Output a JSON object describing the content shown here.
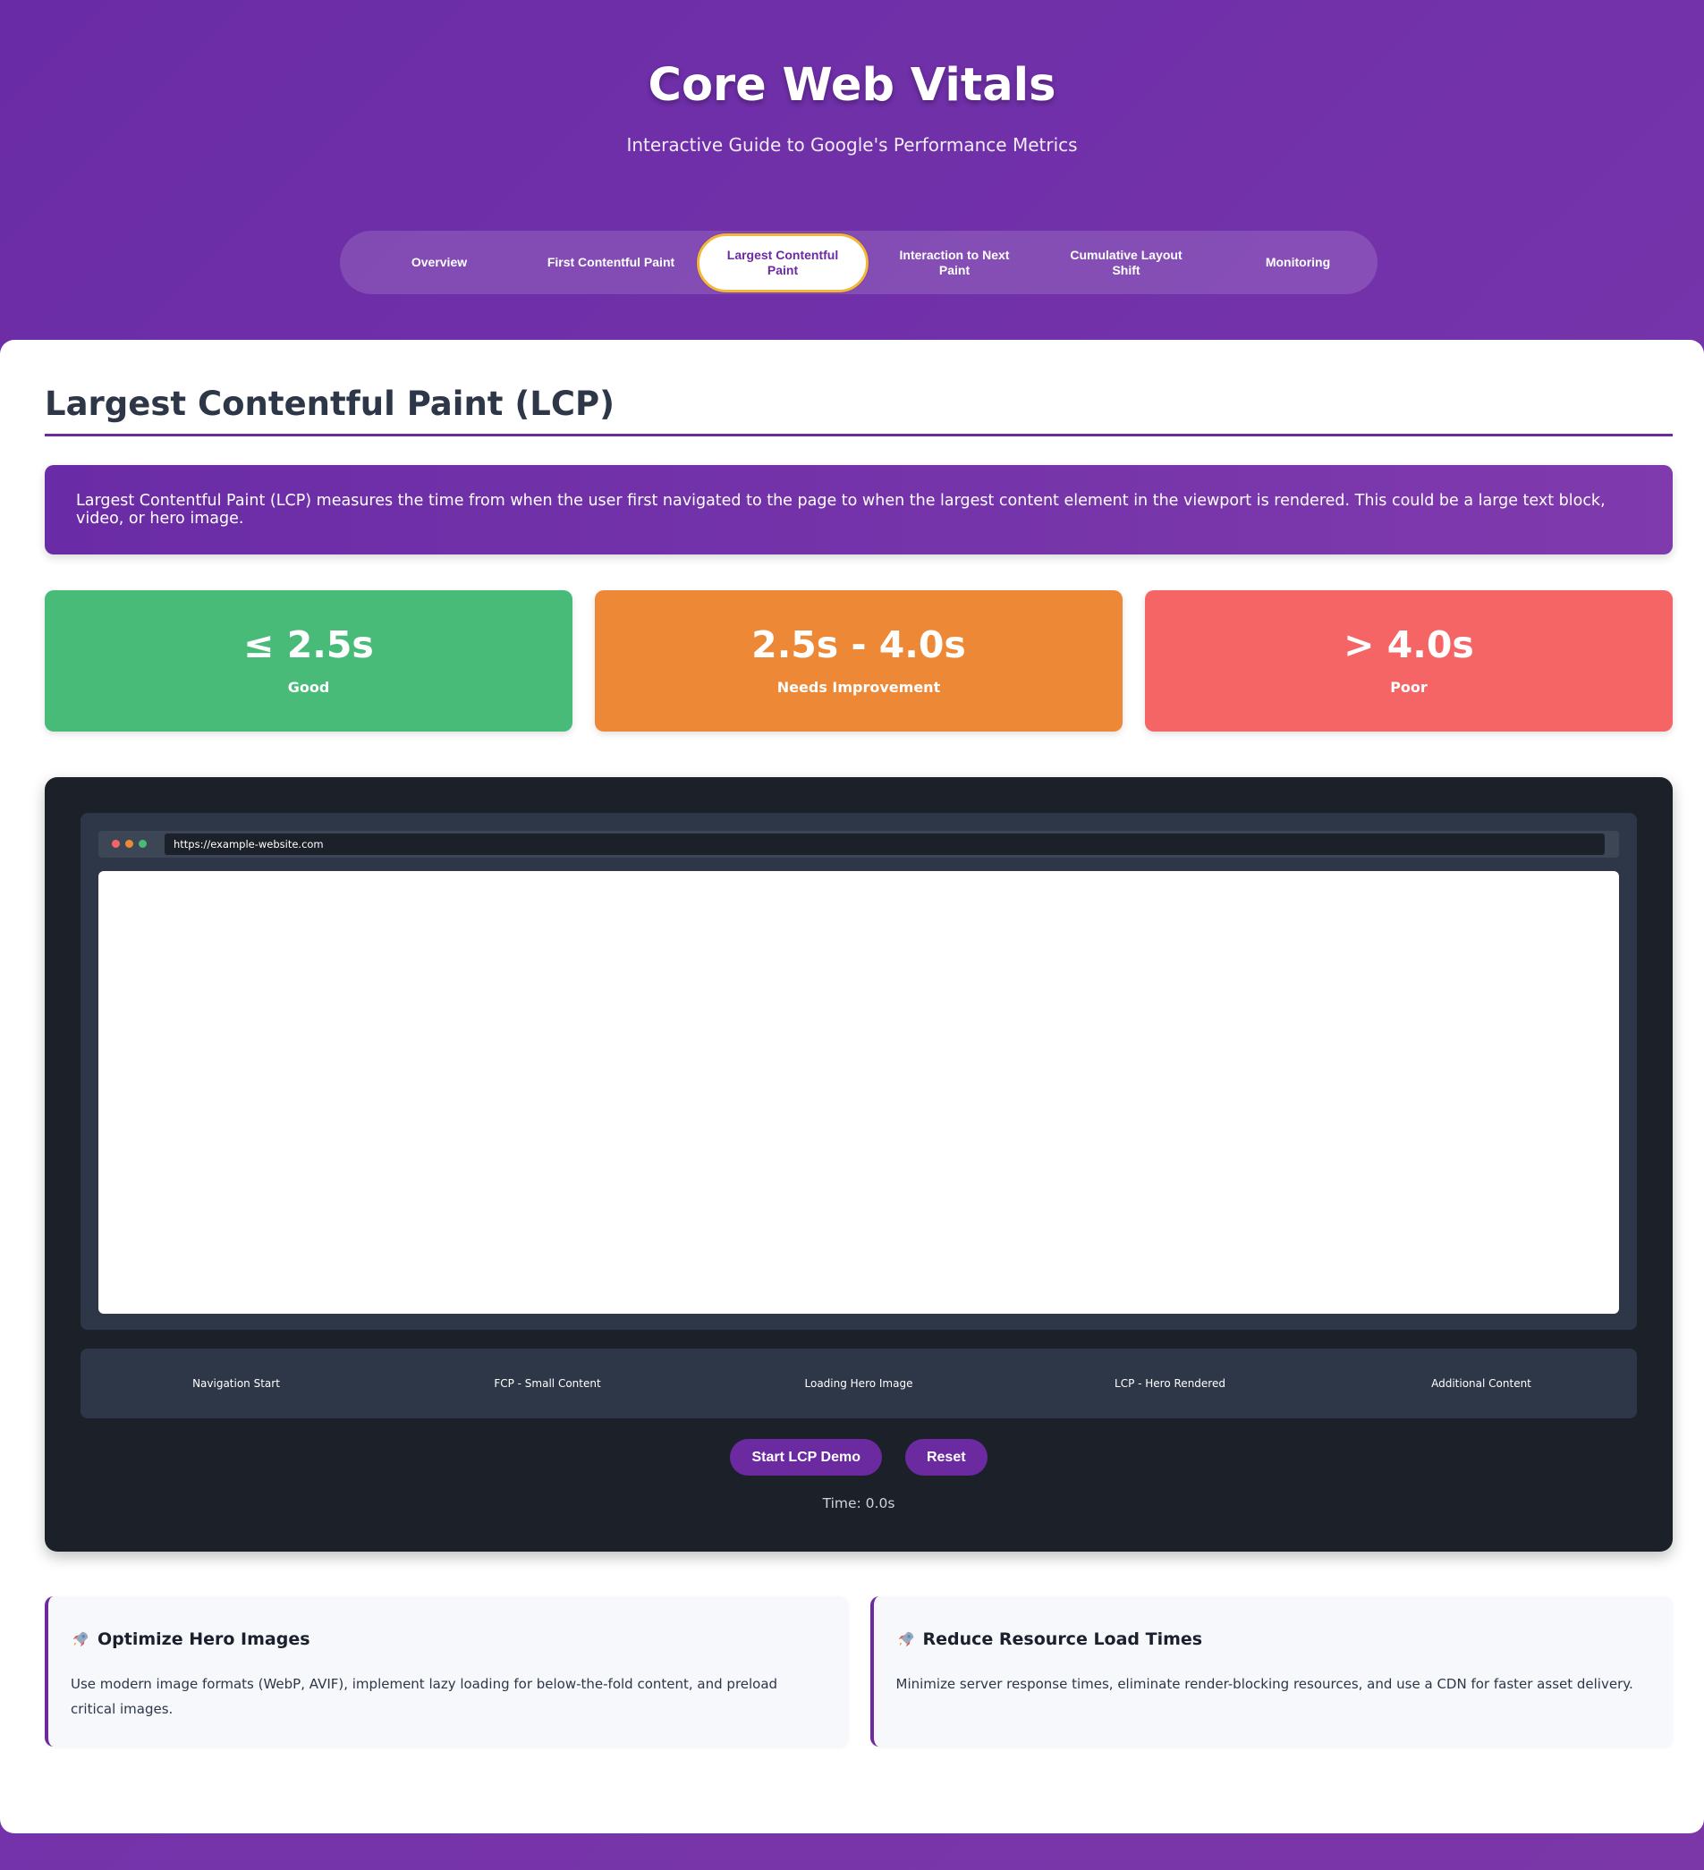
{
  "header": {
    "title": "Core Web Vitals",
    "subtitle": "Interactive Guide to Google's Performance Metrics"
  },
  "nav": {
    "tabs": [
      {
        "label": "Overview",
        "active": false
      },
      {
        "label": "First Contentful Paint",
        "active": false
      },
      {
        "label": "Largest Contentful Paint",
        "active": true
      },
      {
        "label": "Interaction to Next Paint",
        "active": false
      },
      {
        "label": "Cumulative Layout Shift",
        "active": false
      },
      {
        "label": "Monitoring",
        "active": false
      }
    ]
  },
  "section": {
    "title": "Largest Contentful Paint (LCP)",
    "intro": "Largest Contentful Paint (LCP) measures the time from when the user first navigated to the page to when the largest content element in the viewport is rendered. This could be a large text block, video, or hero image."
  },
  "thresholds": [
    {
      "value": "≤ 2.5s",
      "label": "Good",
      "color": "#48bb78"
    },
    {
      "value": "2.5s - 4.0s",
      "label": "Needs Improvement",
      "color": "#ed8936"
    },
    {
      "value": "> 4.0s",
      "label": "Poor",
      "color": "#f56565"
    }
  ],
  "demo": {
    "url": "https://example-website.com",
    "stages": [
      "Navigation Start",
      "FCP - Small Content",
      "Loading Hero Image",
      "LCP - Hero Rendered",
      "Additional Content"
    ],
    "start_label": "Start LCP Demo",
    "reset_label": "Reset",
    "time": "Time: 0.0s"
  },
  "tips": [
    {
      "icon": "rocket-icon",
      "title": "Optimize Hero Images",
      "body": "Use modern image formats (WebP, AVIF), implement lazy loading for below-the-fold content, and preload critical images."
    },
    {
      "icon": "rocket-icon",
      "title": "Reduce Resource Load Times",
      "body": "Minimize server response times, eliminate render-blocking resources, and use a CDN for faster asset delivery."
    }
  ],
  "colors": {
    "brand": "#6b2aa0",
    "active_tab_border": "#f2b736",
    "demo_background": "#1c2029"
  }
}
